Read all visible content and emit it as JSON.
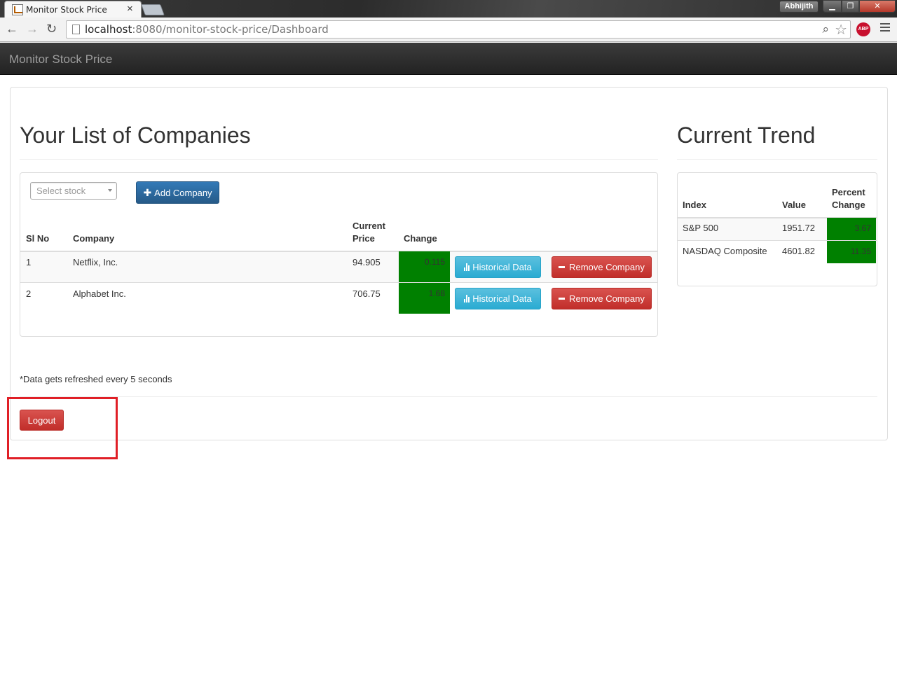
{
  "browser": {
    "tab_title": "Monitor Stock Price",
    "tab_close": "×",
    "user_name": "Abhijith",
    "url_host": "localhost",
    "url_rest": ":8080/monitor-stock-price/Dashboard",
    "abp_label": "ABP",
    "window_buttons": {
      "minimize": "▁",
      "maximize": "❐",
      "close": "✕"
    },
    "nav": {
      "back": "←",
      "forward": "→",
      "reload": "↻"
    }
  },
  "app": {
    "brand": "Monitor Stock Price"
  },
  "companies_section": {
    "title": "Your List of Companies",
    "select_placeholder": "Select stock",
    "add_button": "Add Company",
    "headers": {
      "sl_no": "Sl No",
      "company": "Company",
      "current_price_1": "Current",
      "current_price_2": "Price",
      "change": "Change"
    },
    "rows": [
      {
        "sl": "1",
        "company": "Netflix, Inc.",
        "price": "94.905",
        "change": "0.115",
        "historical": "Historical Data",
        "remove": "Remove Company"
      },
      {
        "sl": "2",
        "company": "Alphabet Inc.",
        "price": "706.75",
        "change": "1.68",
        "historical": "Historical Data",
        "remove": "Remove Company"
      }
    ]
  },
  "trend_section": {
    "title": "Current Trend",
    "headers": {
      "index": "Index",
      "value": "Value",
      "percent_1": "Percent",
      "percent_2": "Change"
    },
    "rows": [
      {
        "index": "S&P 500",
        "value": "1951.72",
        "percent": "3.67"
      },
      {
        "index": "NASDAQ Composite",
        "value": "4601.82",
        "percent": "11.35"
      }
    ]
  },
  "footer": {
    "note": "*Data gets refreshed every 5 seconds",
    "logout": "Logout"
  },
  "colors": {
    "positive_change": "#008000",
    "highlight_box": "#e01f26"
  }
}
